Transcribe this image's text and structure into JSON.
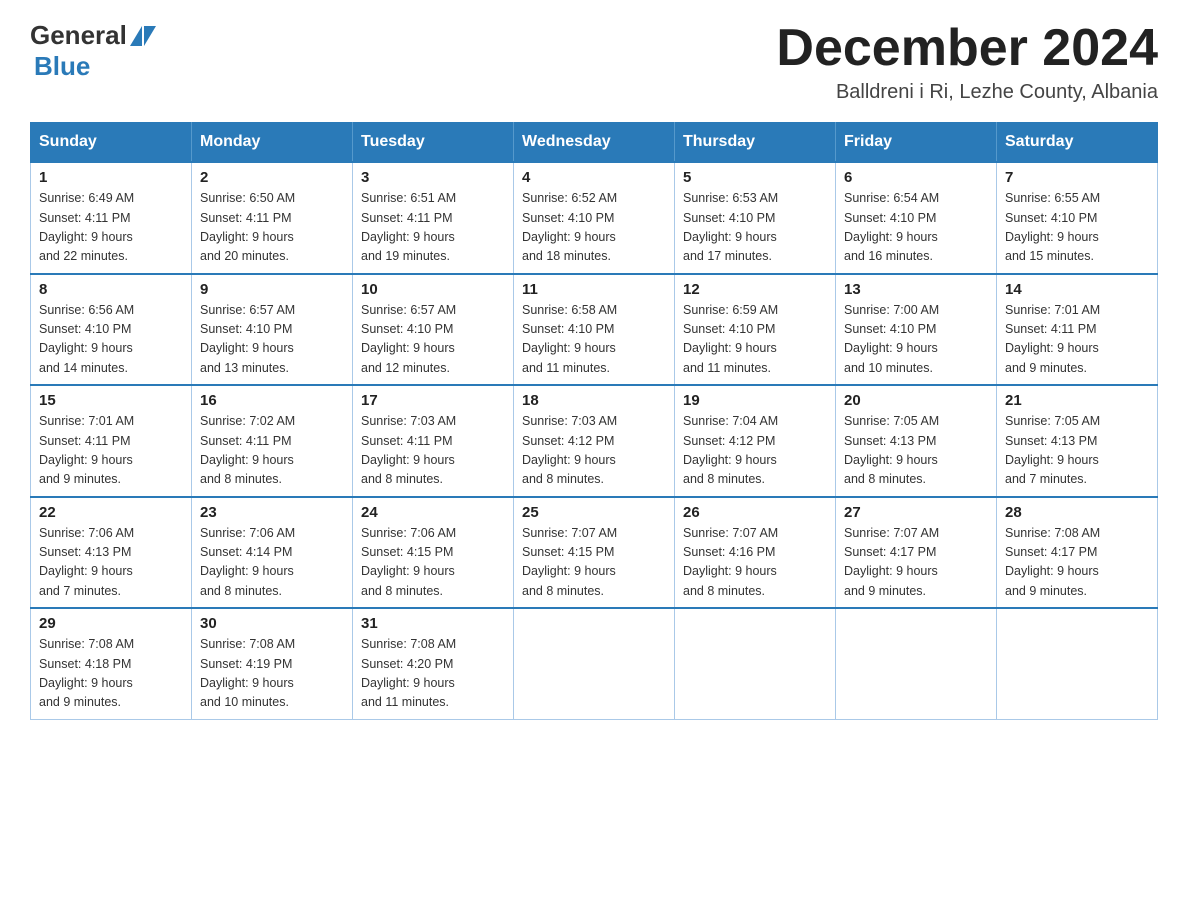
{
  "header": {
    "logo_general": "General",
    "logo_blue": "Blue",
    "month_title": "December 2024",
    "location": "Balldreni i Ri, Lezhe County, Albania"
  },
  "days_of_week": [
    "Sunday",
    "Monday",
    "Tuesday",
    "Wednesday",
    "Thursday",
    "Friday",
    "Saturday"
  ],
  "weeks": [
    [
      {
        "day": "1",
        "sunrise": "6:49 AM",
        "sunset": "4:11 PM",
        "daylight": "9 hours and 22 minutes."
      },
      {
        "day": "2",
        "sunrise": "6:50 AM",
        "sunset": "4:11 PM",
        "daylight": "9 hours and 20 minutes."
      },
      {
        "day": "3",
        "sunrise": "6:51 AM",
        "sunset": "4:11 PM",
        "daylight": "9 hours and 19 minutes."
      },
      {
        "day": "4",
        "sunrise": "6:52 AM",
        "sunset": "4:10 PM",
        "daylight": "9 hours and 18 minutes."
      },
      {
        "day": "5",
        "sunrise": "6:53 AM",
        "sunset": "4:10 PM",
        "daylight": "9 hours and 17 minutes."
      },
      {
        "day": "6",
        "sunrise": "6:54 AM",
        "sunset": "4:10 PM",
        "daylight": "9 hours and 16 minutes."
      },
      {
        "day": "7",
        "sunrise": "6:55 AM",
        "sunset": "4:10 PM",
        "daylight": "9 hours and 15 minutes."
      }
    ],
    [
      {
        "day": "8",
        "sunrise": "6:56 AM",
        "sunset": "4:10 PM",
        "daylight": "9 hours and 14 minutes."
      },
      {
        "day": "9",
        "sunrise": "6:57 AM",
        "sunset": "4:10 PM",
        "daylight": "9 hours and 13 minutes."
      },
      {
        "day": "10",
        "sunrise": "6:57 AM",
        "sunset": "4:10 PM",
        "daylight": "9 hours and 12 minutes."
      },
      {
        "day": "11",
        "sunrise": "6:58 AM",
        "sunset": "4:10 PM",
        "daylight": "9 hours and 11 minutes."
      },
      {
        "day": "12",
        "sunrise": "6:59 AM",
        "sunset": "4:10 PM",
        "daylight": "9 hours and 11 minutes."
      },
      {
        "day": "13",
        "sunrise": "7:00 AM",
        "sunset": "4:10 PM",
        "daylight": "9 hours and 10 minutes."
      },
      {
        "day": "14",
        "sunrise": "7:01 AM",
        "sunset": "4:11 PM",
        "daylight": "9 hours and 9 minutes."
      }
    ],
    [
      {
        "day": "15",
        "sunrise": "7:01 AM",
        "sunset": "4:11 PM",
        "daylight": "9 hours and 9 minutes."
      },
      {
        "day": "16",
        "sunrise": "7:02 AM",
        "sunset": "4:11 PM",
        "daylight": "9 hours and 8 minutes."
      },
      {
        "day": "17",
        "sunrise": "7:03 AM",
        "sunset": "4:11 PM",
        "daylight": "9 hours and 8 minutes."
      },
      {
        "day": "18",
        "sunrise": "7:03 AM",
        "sunset": "4:12 PM",
        "daylight": "9 hours and 8 minutes."
      },
      {
        "day": "19",
        "sunrise": "7:04 AM",
        "sunset": "4:12 PM",
        "daylight": "9 hours and 8 minutes."
      },
      {
        "day": "20",
        "sunrise": "7:05 AM",
        "sunset": "4:13 PM",
        "daylight": "9 hours and 8 minutes."
      },
      {
        "day": "21",
        "sunrise": "7:05 AM",
        "sunset": "4:13 PM",
        "daylight": "9 hours and 7 minutes."
      }
    ],
    [
      {
        "day": "22",
        "sunrise": "7:06 AM",
        "sunset": "4:13 PM",
        "daylight": "9 hours and 7 minutes."
      },
      {
        "day": "23",
        "sunrise": "7:06 AM",
        "sunset": "4:14 PM",
        "daylight": "9 hours and 8 minutes."
      },
      {
        "day": "24",
        "sunrise": "7:06 AM",
        "sunset": "4:15 PM",
        "daylight": "9 hours and 8 minutes."
      },
      {
        "day": "25",
        "sunrise": "7:07 AM",
        "sunset": "4:15 PM",
        "daylight": "9 hours and 8 minutes."
      },
      {
        "day": "26",
        "sunrise": "7:07 AM",
        "sunset": "4:16 PM",
        "daylight": "9 hours and 8 minutes."
      },
      {
        "day": "27",
        "sunrise": "7:07 AM",
        "sunset": "4:17 PM",
        "daylight": "9 hours and 9 minutes."
      },
      {
        "day": "28",
        "sunrise": "7:08 AM",
        "sunset": "4:17 PM",
        "daylight": "9 hours and 9 minutes."
      }
    ],
    [
      {
        "day": "29",
        "sunrise": "7:08 AM",
        "sunset": "4:18 PM",
        "daylight": "9 hours and 9 minutes."
      },
      {
        "day": "30",
        "sunrise": "7:08 AM",
        "sunset": "4:19 PM",
        "daylight": "9 hours and 10 minutes."
      },
      {
        "day": "31",
        "sunrise": "7:08 AM",
        "sunset": "4:20 PM",
        "daylight": "9 hours and 11 minutes."
      },
      null,
      null,
      null,
      null
    ]
  ]
}
